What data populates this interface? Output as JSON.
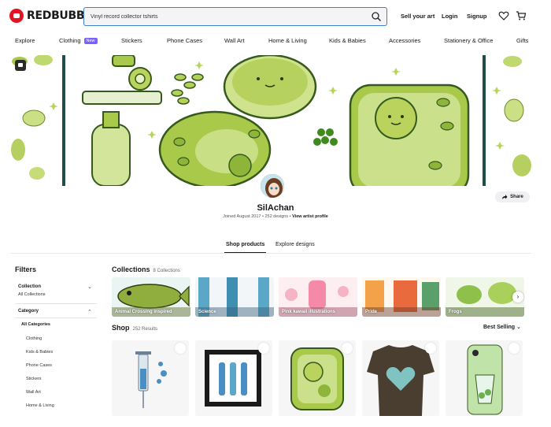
{
  "header": {
    "logo_text": "REDBUBBLE",
    "search_value": "Vinyl record collector tshirts",
    "links": {
      "sell": "Sell your art",
      "login": "Login",
      "signup": "Signup"
    }
  },
  "nav": {
    "items": [
      "Explore",
      "Clothing",
      "Stickers",
      "Phone Cases",
      "Wall Art",
      "Home & Living",
      "Kids & Babies",
      "Accessories",
      "Stationery & Office",
      "Gifts"
    ],
    "new_badge": "New"
  },
  "profile": {
    "name": "SilAchan",
    "joined": "Joined August 2017",
    "designs": "252 designs",
    "view_profile": "View artist profile",
    "share": "Share"
  },
  "tabs": [
    "Shop products",
    "Explore designs"
  ],
  "filters": {
    "title": "Filters",
    "collection_label": "Collection",
    "collection_value": "All Collections",
    "category_label": "Category",
    "categories": [
      "All Categories",
      "Clothing",
      "Kids & Babies",
      "Phone Cases",
      "Stickers",
      "Wall Art",
      "Home & Living"
    ]
  },
  "collections": {
    "title": "Collections",
    "count": "8 Collections",
    "items": [
      "Animal Crossing inspired",
      "Science",
      "Pink kawaii illustrations",
      "Pride",
      "Frogs"
    ]
  },
  "shop": {
    "title": "Shop",
    "count": "252 Results",
    "sort": "Best Selling"
  },
  "colors": {
    "brand_red": "#e41321",
    "search_border": "#3f80c6",
    "new_badge": "#7b61ff",
    "banner_green": "#a8c94a"
  }
}
